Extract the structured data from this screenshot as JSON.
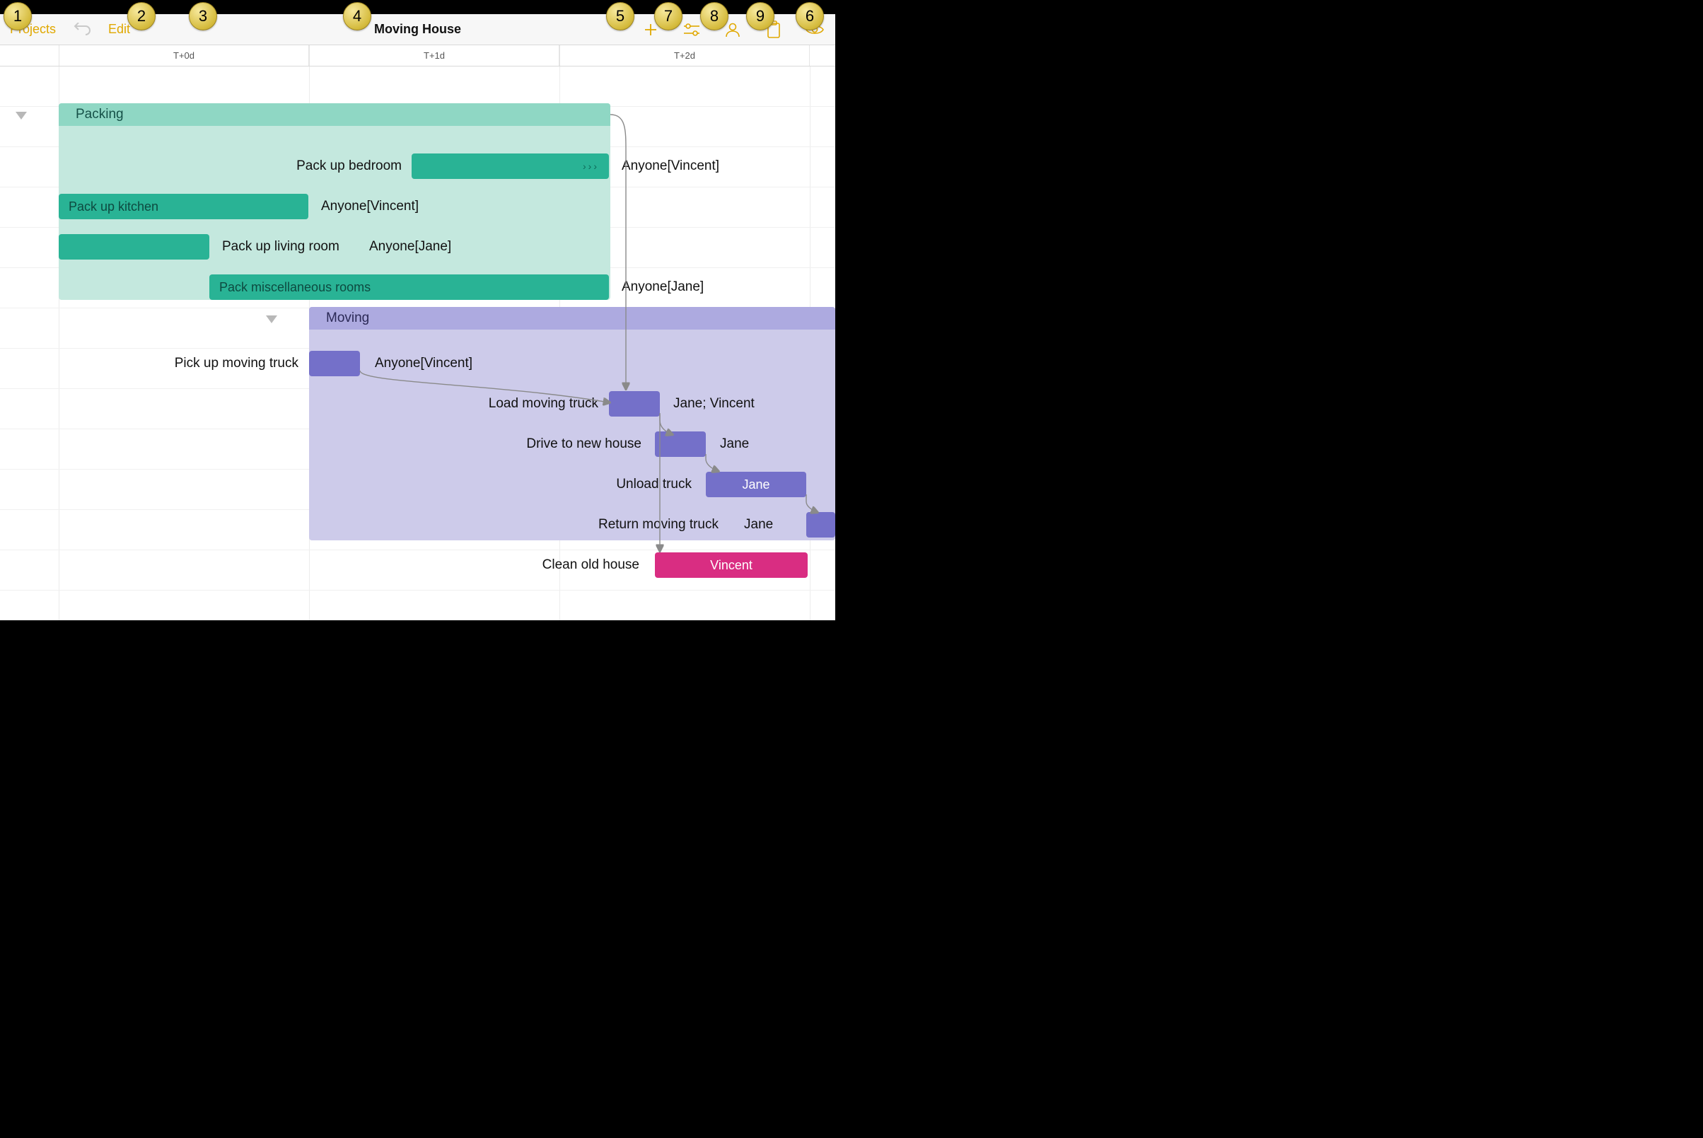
{
  "toolbar": {
    "projects": "Projects",
    "edit": "Edit",
    "title": "Moving House"
  },
  "timeline": {
    "ticks": [
      "T+0d",
      "T+1d",
      "T+2d"
    ]
  },
  "callouts": [
    "1",
    "2",
    "3",
    "4",
    "5",
    "7",
    "8",
    "9",
    "6"
  ],
  "chart_data": {
    "type": "gantt",
    "time_unit": "days",
    "groups": [
      {
        "name": "Packing",
        "color": "teal",
        "start": 0.0,
        "end": 2.2,
        "tasks": [
          {
            "name": "Pack up bedroom",
            "start": 1.4,
            "end": 2.2,
            "resource": "Anyone[Vincent]",
            "interrupted": true
          },
          {
            "name": "Pack up kitchen",
            "start": 0.0,
            "end": 1.0,
            "resource": "Anyone[Vincent]"
          },
          {
            "name": "Pack up living room",
            "start": 0.0,
            "end": 0.6,
            "resource": "Anyone[Jane]"
          },
          {
            "name": "Pack miscellaneous rooms",
            "start": 0.6,
            "end": 2.2,
            "resource": "Anyone[Jane]"
          }
        ]
      },
      {
        "name": "Moving",
        "color": "purple",
        "start": 1.0,
        "end": 3.4,
        "tasks": [
          {
            "name": "Pick up moving truck",
            "start": 1.0,
            "end": 1.2,
            "resource": "Anyone[Vincent]"
          },
          {
            "name": "Load moving truck",
            "start": 2.2,
            "end": 2.4,
            "resource": "Jane; Vincent"
          },
          {
            "name": "Drive to new house",
            "start": 2.4,
            "end": 2.6,
            "resource": "Jane"
          },
          {
            "name": "Unload truck",
            "start": 2.6,
            "end": 3.0,
            "resource": "Jane"
          },
          {
            "name": "Return moving truck",
            "start": 3.0,
            "end": 3.2,
            "resource": "Jane"
          },
          {
            "name": "Clean old house",
            "start": 2.4,
            "end": 3.0,
            "resource": "Vincent",
            "color": "pink"
          }
        ]
      }
    ],
    "dependencies": [
      {
        "from": "Packing",
        "to": "Load moving truck"
      },
      {
        "from": "Pick up moving truck",
        "to": "Load moving truck"
      },
      {
        "from": "Load moving truck",
        "to": "Drive to new house"
      },
      {
        "from": "Drive to new house",
        "to": "Unload truck"
      },
      {
        "from": "Unload truck",
        "to": "Return moving truck"
      },
      {
        "from": "Load moving truck",
        "to": "Clean old house"
      }
    ]
  }
}
